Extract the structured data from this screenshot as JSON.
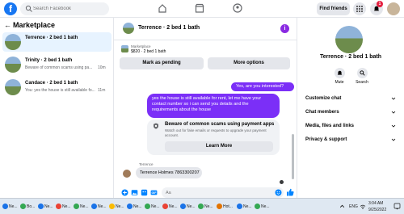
{
  "top_bar": {
    "logo": "f",
    "search_placeholder": "Search Facebook",
    "find_friends": "Find friends",
    "notification_count": "1"
  },
  "left": {
    "title": "Marketplace",
    "conversations": [
      {
        "name": "Terrence · 2 bed 1 bath",
        "preview": ""
      },
      {
        "name": "Trinity · 2 bed 1 bath",
        "preview": "Beware of common scams using pa...",
        "time": "10m"
      },
      {
        "name": "Candace · 2 bed 1 bath",
        "preview": "You: yes the house is still available fo...",
        "time": "11m"
      }
    ]
  },
  "chat": {
    "title": "Terrence · 2 bed 1 bath",
    "listing_label": "Marketplace",
    "listing_price": "$820 · 2 bed 1 bath",
    "mark_pending": "Mark as pending",
    "more_options": "More options",
    "messages": {
      "out1": "Yes, are you interested?",
      "out2": "yes the house is still available for rent, let me have your contact number so i can send you details and the requirements about the house",
      "scam_title": "Beware of common scams using payment apps",
      "scam_body": "Watch out for fake emails or requests to upgrade your payment account.",
      "learn_more": "Learn More",
      "sender": "Terrence",
      "in1": "Terrence Holmes 7863300207"
    },
    "composer_placeholder": "Aa"
  },
  "right": {
    "title": "Terrence · 2 bed 1 bath",
    "mute": "Mute",
    "search": "Search",
    "rows": [
      "Customize chat",
      "Chat members",
      "Media, files and links",
      "Privacy & support"
    ]
  },
  "taskbar": {
    "items": [
      "Ne...",
      "Bo...",
      "Ne...",
      "Ne...",
      "Ne...",
      "Ne...",
      "Ne...",
      "Ne...",
      "Ne...",
      "Ne...",
      "Ne...",
      "Ne...",
      "Hot...",
      "Ne...",
      "Ne..."
    ],
    "lang": "ENG",
    "time": "3:04 AM",
    "date": "9/25/2022"
  }
}
